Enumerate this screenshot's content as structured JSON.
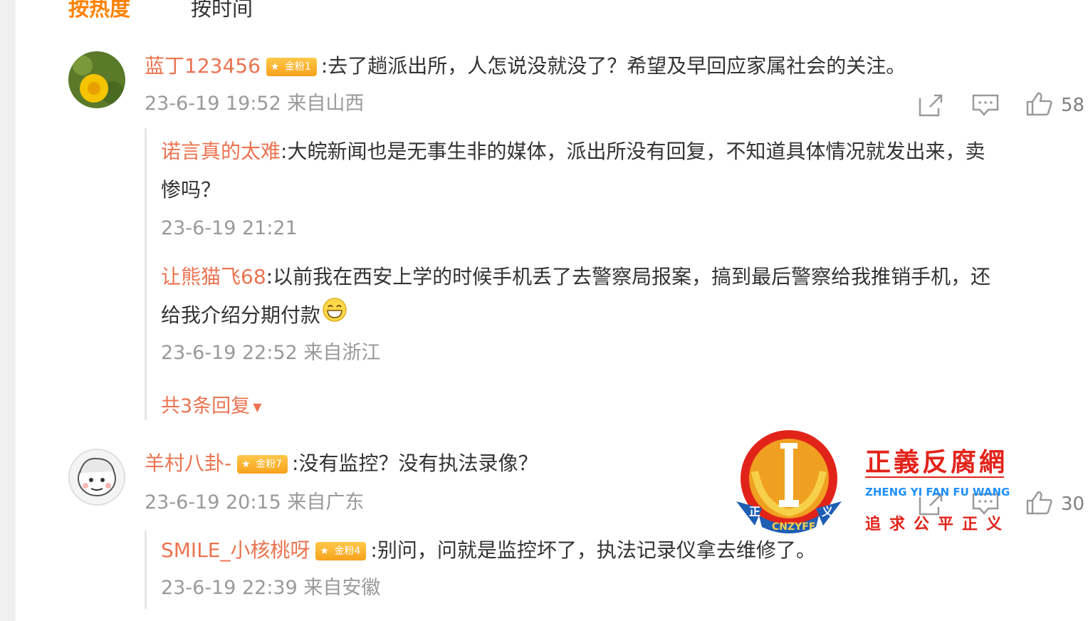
{
  "sort_tabs": {
    "hot": "按热度",
    "time": "按时间"
  },
  "comments": [
    {
      "user": "蓝丁123456",
      "badge": "金粉1",
      "text": ":去了趟派出所，人怎说没就没了？希望及早回应家属社会的关注。",
      "time": "23-6-19 19:52 来自山西",
      "likes": "58",
      "replies": [
        {
          "user": "诺言真的太难",
          "text_line1": ":大皖新闻也是无事生非的媒体，派出所没有回复，不知道具体情况就发出来，卖",
          "text_line2": "惨吗？",
          "time": "23-6-19 21:21"
        },
        {
          "user": "让熊猫飞68",
          "text_line1": ":以前我在西安上学的时候手机丢了去警察局报案，搞到最后警察给我推销手机，还",
          "text_line2": "给我介绍分期付款",
          "time": "23-6-19 22:52 来自浙江"
        }
      ],
      "more_replies": "共3条回复"
    },
    {
      "user": "羊村八卦-",
      "badge": "金粉7",
      "text": ":没有监控？没有执法录像？",
      "time": "23-6-19 20:15 来自广东",
      "likes": "30",
      "replies": [
        {
          "user": "SMILE_小核桃呀",
          "badge": "金粉4",
          "text_line1": ":别问，问就是监控坏了，执法记录仪拿去维修了。",
          "time": "23-6-19 22:39 来自安徽"
        }
      ]
    }
  ],
  "watermark": {
    "title": "正義反腐網",
    "pinyin": "ZHENG YI FAN FU WANG",
    "slogan": "追求公平正义",
    "emblem_text": "CNZYFF",
    "emblem_side_left": "正",
    "emblem_side_right": "义"
  },
  "colors": {
    "accent": "#ff8200",
    "username": "#eb7350",
    "watermark_red": "#e2231a",
    "watermark_blue": "#1e90ff"
  }
}
